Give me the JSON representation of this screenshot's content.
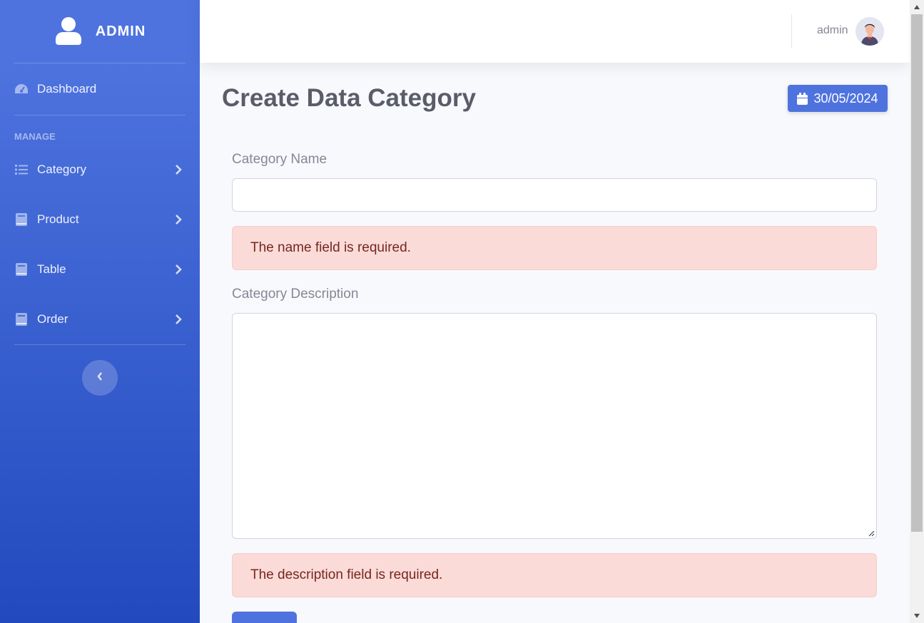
{
  "sidebar": {
    "brand": "ADMIN",
    "dashboard_label": "Dashboard",
    "heading": "MANAGE",
    "items": [
      {
        "label": "Category",
        "icon": "list-icon"
      },
      {
        "label": "Product",
        "icon": "book-icon"
      },
      {
        "label": "Table",
        "icon": "book-icon"
      },
      {
        "label": "Order",
        "icon": "book-icon"
      }
    ]
  },
  "topbar": {
    "user_name": "admin"
  },
  "main": {
    "page_title": "Create Data Category",
    "date": "30/05/2024",
    "form": {
      "name_label": "Category Name",
      "name_value": "",
      "name_error": "The name field is required.",
      "description_label": "Category Description",
      "description_value": "",
      "description_error": "The description field is required."
    }
  },
  "colors": {
    "primary": "#4e73df",
    "sidebar_gradient_end": "#224abe",
    "alert_bg": "#fadbd8",
    "alert_text": "#78261f"
  }
}
